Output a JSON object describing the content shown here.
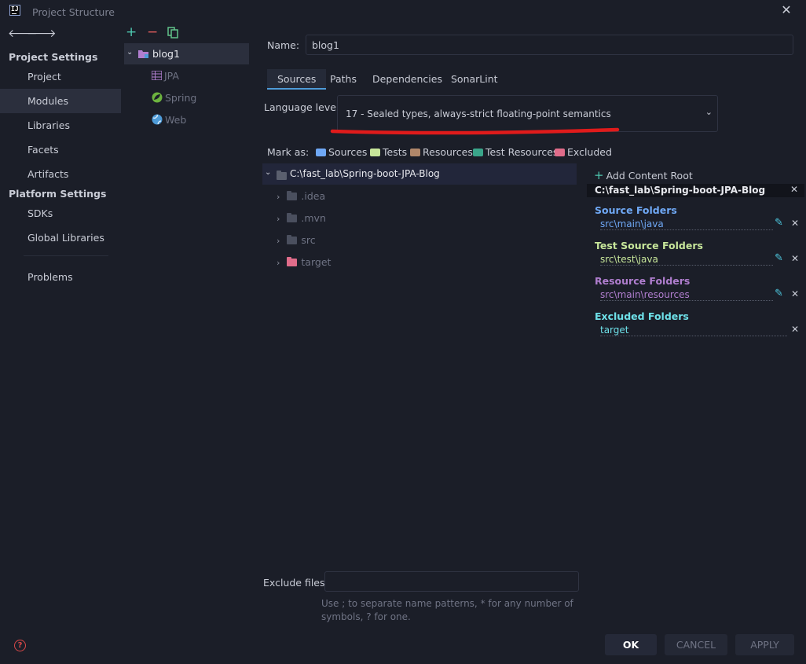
{
  "window": {
    "title": "Project Structure"
  },
  "nav": {
    "back_icon": "arrow-left-icon",
    "forward_icon": "arrow-right-icon",
    "project_settings_header": "Project Settings",
    "project_settings_items": [
      "Project",
      "Modules",
      "Libraries",
      "Facets",
      "Artifacts"
    ],
    "platform_settings_header": "Platform Settings",
    "platform_settings_items": [
      "SDKs",
      "Global Libraries"
    ],
    "problems": "Problems",
    "selected": "Modules"
  },
  "modules": {
    "toolbar": {
      "add": "+",
      "remove": "−",
      "copy_icon": "copy-icon"
    },
    "module_name": "blog1",
    "facets": [
      "JPA",
      "Spring",
      "Web"
    ]
  },
  "module_settings": {
    "name_label": "Name:",
    "name_value": "blog1",
    "tabs": [
      "Sources",
      "Paths",
      "Dependencies",
      "SonarLint"
    ],
    "active_tab": "Sources",
    "language_level_label": "Language level:",
    "language_level_value": "17 - Sealed types, always-strict floating-point semantics",
    "mark_as_label": "Mark as:",
    "mark_as": [
      "Sources",
      "Tests",
      "Resources",
      "Test Resources",
      "Excluded"
    ]
  },
  "file_tree": {
    "root": "C:\\fast_lab\\Spring-boot-JPA-Blog",
    "children": [
      ".idea",
      ".mvn",
      "src",
      "target"
    ]
  },
  "content_roots": {
    "add_label": "Add Content Root",
    "root_path": "C:\\fast_lab\\Spring-boot-JPA-Blog",
    "source_folders_header": "Source Folders",
    "source_folder": "src\\main\\java",
    "test_source_folders_header": "Test Source Folders",
    "test_source_folder": "src\\test\\java",
    "resource_folders_header": "Resource Folders",
    "resource_folder": "src\\main\\resources",
    "excluded_folders_header": "Excluded Folders",
    "excluded_folder": "target"
  },
  "exclude_files": {
    "label": "Exclude files:",
    "value": "",
    "hint": "Use ; to separate name patterns, * for any number of symbols, ? for one."
  },
  "buttons": {
    "ok": "OK",
    "cancel": "CANCEL",
    "apply": "APPLY"
  },
  "colors": {
    "background": "#1b1e28",
    "selection": "#2b2f3d",
    "sources": "#6fa8f5",
    "tests": "#c7e69a",
    "resources": "#b07ecf",
    "excluded": "#e06c8a",
    "excluded_header": "#6ee0e8",
    "annotation_red": "#e01b1b"
  }
}
